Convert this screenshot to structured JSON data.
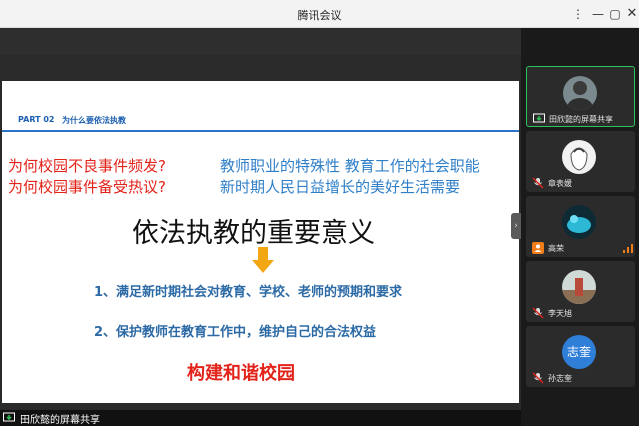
{
  "window": {
    "title": "腾讯会议"
  },
  "slide": {
    "part": "PART 02",
    "part_title": "为什么要依法执教",
    "questions": [
      "为何校园不良事件频发?",
      "为何校园事件备受热议?"
    ],
    "reasons": [
      "教师职业的特殊性 教育工作的社会职能",
      "新时期人民日益增长的美好生活需要"
    ],
    "main_title": "依法执教的重要意义",
    "points": [
      "1、满足新时期社会对教育、学校、老师的预期和要求",
      "2、保护教师在教育工作中，维护自己的合法权益"
    ],
    "slogan": "构建和谐校园"
  },
  "share_bar": {
    "label": "田欣懿的屏幕共享"
  },
  "participants": [
    {
      "name": "田欣懿的屏幕共享",
      "active": true
    },
    {
      "name": "章表媛"
    },
    {
      "name": "高荣"
    },
    {
      "name": "李天旭"
    },
    {
      "name": "孙志奎",
      "avatar_text": "志奎"
    }
  ],
  "colors": {
    "accent_green": "#2ec35b",
    "slide_red": "#e2231a",
    "slide_blue": "#2f7fc8"
  }
}
